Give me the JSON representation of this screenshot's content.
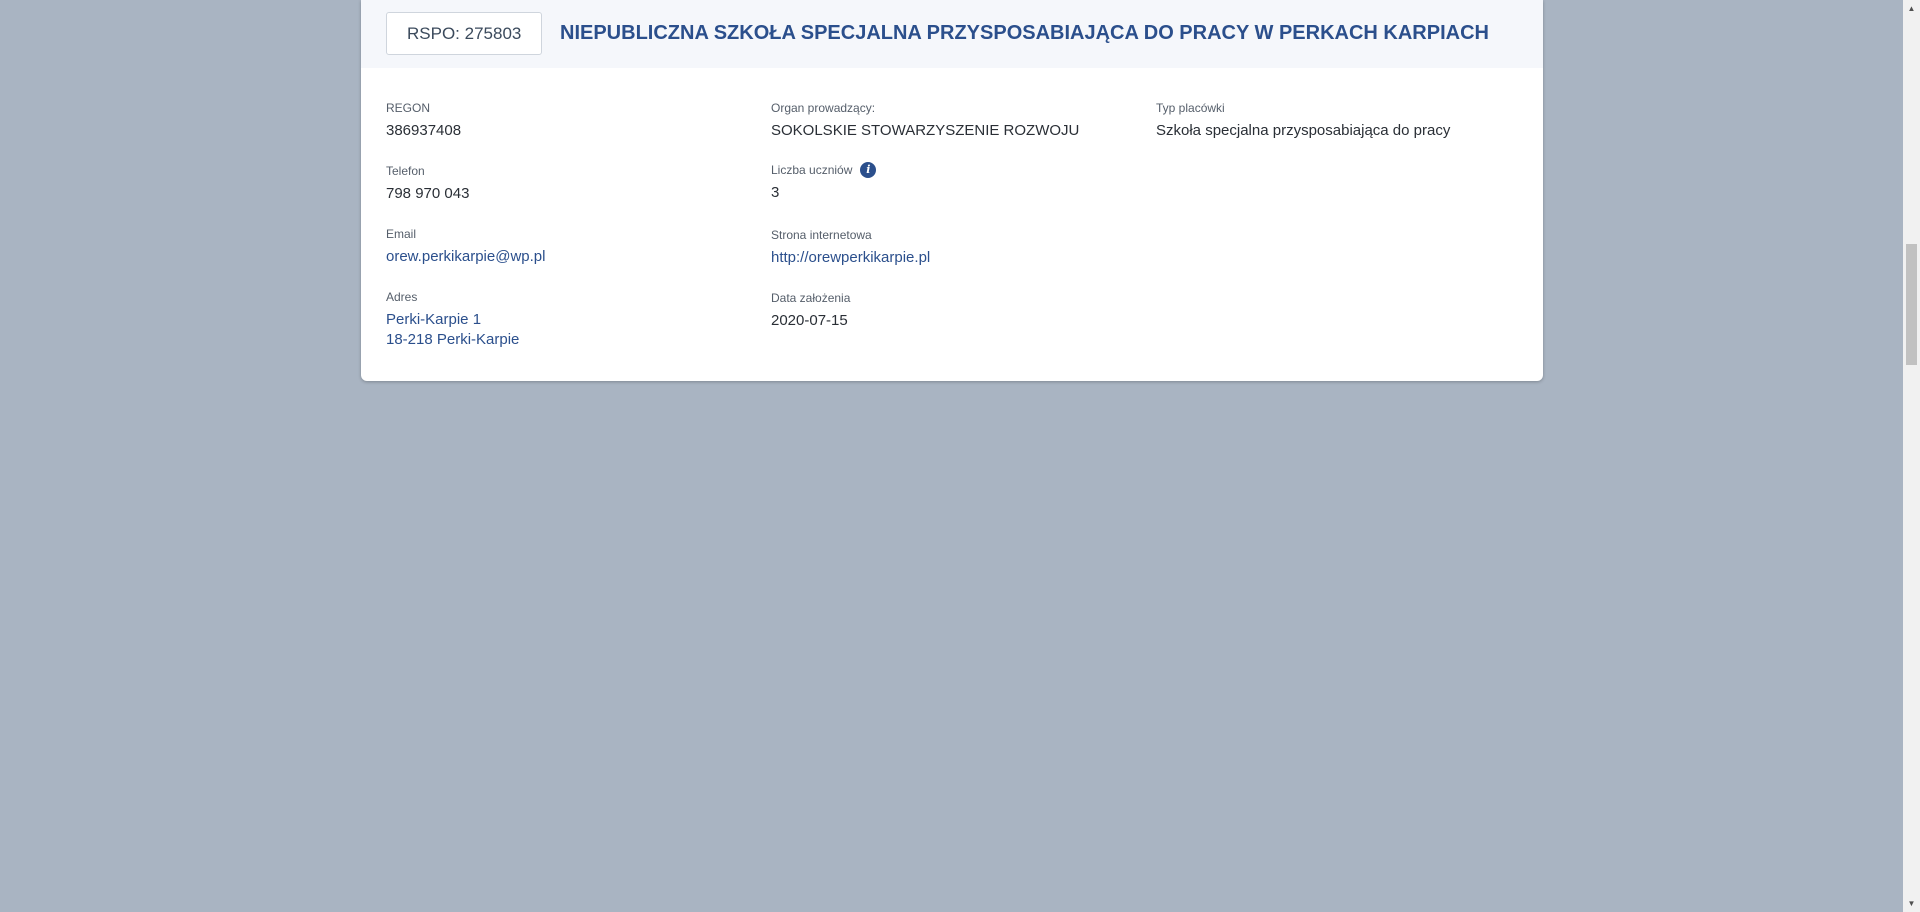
{
  "header": {
    "rspo": "RSPO: 275803",
    "school_name": "NIEPUBLICZNA SZKOŁA SPECJALNA PRZYSPOSABIAJĄCA DO PRACY W PERKACH KARPIACH"
  },
  "fields": {
    "regon": {
      "label": "REGON",
      "value": "386937408"
    },
    "organ": {
      "label": "Organ prowadzący:",
      "value": "SOKOLSKIE STOWARZYSZENIE ROZWOJU"
    },
    "typ": {
      "label": "Typ placówki",
      "value": "Szkoła specjalna przysposabiająca do pracy"
    },
    "telefon": {
      "label": "Telefon",
      "value": "798 970 043"
    },
    "uczniowie": {
      "label": "Liczba uczniów",
      "value": "3",
      "info_icon": "info-icon"
    },
    "email": {
      "label": "Email",
      "value": "orew.perkikarpie@wp.pl"
    },
    "strona": {
      "label": "Strona internetowa",
      "value": "http://orewperkikarpie.pl"
    },
    "adres": {
      "label": "Adres",
      "line1": "Perki-Karpie 1",
      "line2": "18-218 Perki-Karpie"
    },
    "data_zalozenia": {
      "label": "Data założenia",
      "value": "2020-07-15"
    }
  },
  "colors": {
    "background": "#a9b4c2",
    "accent": "#2b4f8c",
    "header_bg": "#f5f7fb"
  }
}
